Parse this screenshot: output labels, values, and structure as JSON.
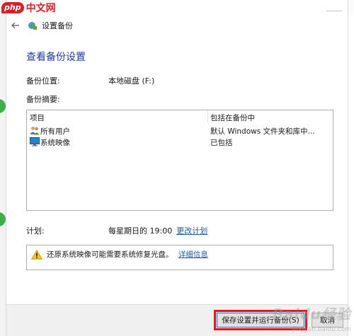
{
  "site_logo": {
    "badge": "php",
    "name": "中文网"
  },
  "nav": {
    "back_label": "←",
    "title": "设置备份"
  },
  "page": {
    "title": "查看备份设置",
    "backup_location_label": "备份位置:",
    "backup_location_value": "本地磁盘 (F:)",
    "summary_label": "备份摘要:"
  },
  "summary_table": {
    "columns": [
      "项目",
      "包括在备份中"
    ],
    "rows": [
      {
        "name": "所有用户",
        "status": "默认 Windows 文件夹和库中...",
        "icon": "users-icon"
      },
      {
        "name": "系统映像",
        "status": "已包括",
        "icon": "monitor-icon"
      }
    ]
  },
  "schedule": {
    "label": "计划:",
    "value": "每星期日的 19:00",
    "change_link": "更改计划"
  },
  "warning": {
    "icon": "warning-icon",
    "text": "还原系统映像可能需要系统修复光盘。",
    "link": "详细信息"
  },
  "buttons": {
    "save_run": "保存设置并运行备份(S)",
    "cancel": "取消"
  },
  "watermark": {
    "text": "Baidu经验",
    "sub": "jingyan.baidu.com"
  },
  "colors": {
    "title_blue": "#1e3d9b",
    "link_blue": "#1e5aa8",
    "highlight_red": "#e8131b",
    "logo_red": "#d61f26"
  }
}
